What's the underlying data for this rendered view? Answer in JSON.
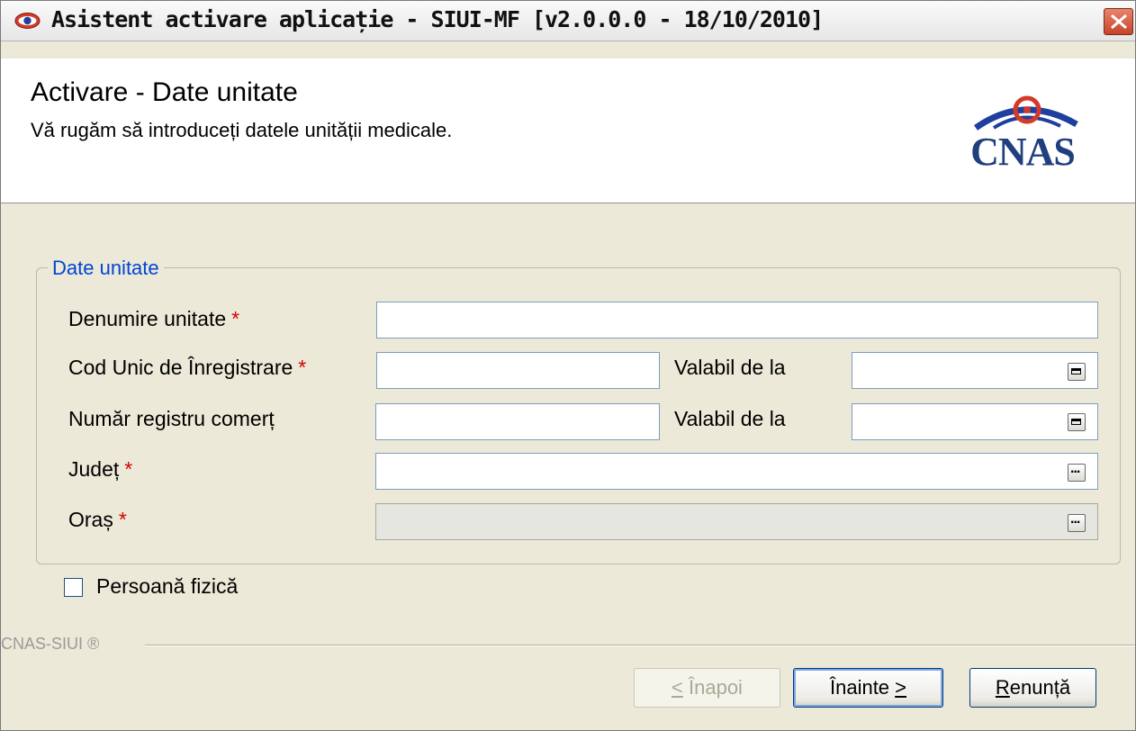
{
  "window": {
    "title": "Asistent activare aplicație - SIUI-MF [v2.0.0.0 - 18/10/2010]"
  },
  "header": {
    "title": "Activare - Date unitate",
    "subtitle": "Vă rugăm să introduceți datele unității medicale.",
    "logo_text": "CNAS"
  },
  "group": {
    "legend": "Date unitate"
  },
  "fields": {
    "denumire_label": "Denumire unitate",
    "denumire_value": "",
    "cui_label": "Cod Unic de Înregistrare",
    "cui_value": "",
    "valabil1_label": "Valabil de la",
    "valabil1_value": "",
    "nr_reg_label": "Număr registru comerț",
    "nr_reg_value": "",
    "valabil2_label": "Valabil de la",
    "valabil2_value": "",
    "judet_label": "Județ",
    "judet_value": "",
    "oras_label": "Oraș",
    "oras_value": "",
    "required_mark": "*"
  },
  "checkbox": {
    "label": "Persoană fizică",
    "checked": false
  },
  "footer": {
    "brand": "CNAS-SIUI ®",
    "back_label_mn": "<",
    "back_label": " Înapoi",
    "next_label": "Înainte ",
    "next_label_mn": ">",
    "cancel_label_mn": "R",
    "cancel_label": "enunță"
  },
  "colors": {
    "accent_blue": "#0046d5",
    "required_red": "#d60000",
    "dialog_bg": "#ece9d8"
  }
}
